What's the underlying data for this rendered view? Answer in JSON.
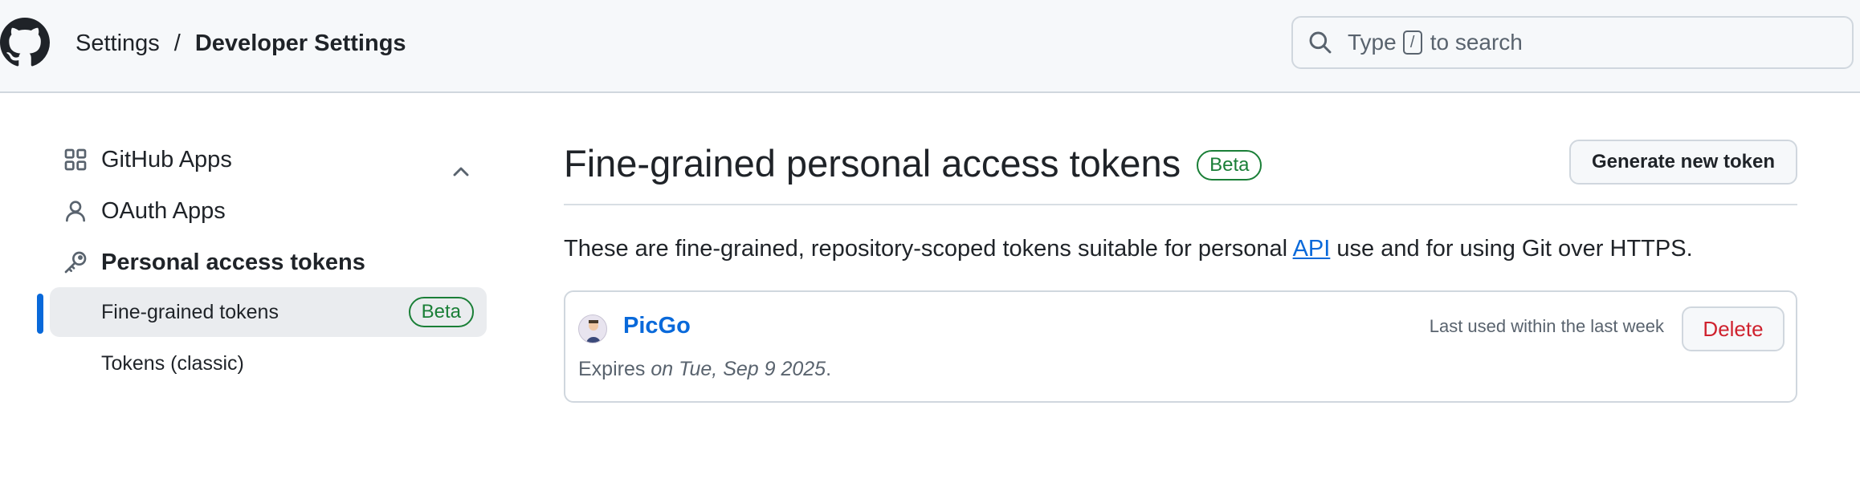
{
  "header": {
    "breadcrumb": {
      "root": "Settings",
      "separator": "/",
      "current": "Developer Settings"
    },
    "search": {
      "prefix": "Type",
      "key": "/",
      "suffix": "to search"
    }
  },
  "sidebar": {
    "items": [
      {
        "label": "GitHub Apps",
        "icon": "apps-grid-icon"
      },
      {
        "label": "OAuth Apps",
        "icon": "person-icon"
      },
      {
        "label": "Personal access tokens",
        "icon": "key-icon",
        "expanded": true
      }
    ],
    "sub_items": [
      {
        "label": "Fine-grained tokens",
        "badge": "Beta",
        "active": true
      },
      {
        "label": "Tokens (classic)"
      }
    ]
  },
  "main": {
    "title": "Fine-grained personal access tokens",
    "title_badge": "Beta",
    "generate_button": "Generate new token",
    "description": {
      "before": "These are fine-grained, repository-scoped tokens suitable for personal ",
      "link": "API",
      "after": " use and for using Git over HTTPS."
    },
    "tokens": [
      {
        "name": "PicGo",
        "last_used": "Last used within the last week",
        "delete_label": "Delete",
        "expires_prefix": "Expires",
        "expires_date": "on Tue, Sep 9 2025",
        "expires_suffix": "."
      }
    ]
  },
  "colors": {
    "accent": "#0969da",
    "success": "#1a7f37",
    "danger": "#cf222e",
    "header_bg": "#f6f8fa"
  }
}
